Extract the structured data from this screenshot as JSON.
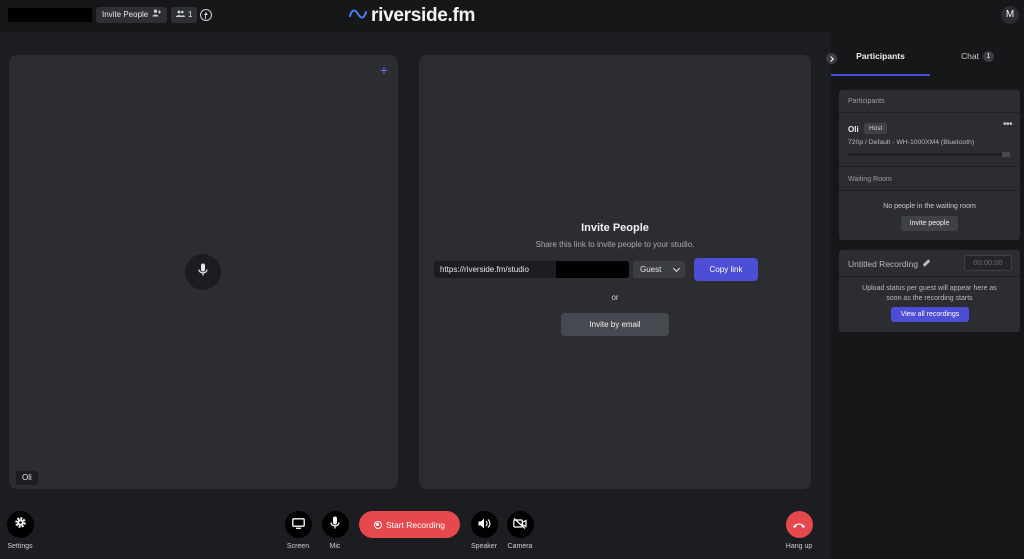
{
  "topbar": {
    "invite_label": "Invite People",
    "participant_count": "1",
    "logo_text": "riverside.fm",
    "avatar_initial": "M"
  },
  "left_tile": {
    "name_tag": "Oli"
  },
  "invite_panel": {
    "title": "Invite People",
    "subtitle": "Share this link to invite people to your studio.",
    "link_text": "https://riverside.fm/studio",
    "role_value": "Guest",
    "copy_label": "Copy link",
    "or_label": "or",
    "email_label": "Invite by email"
  },
  "sidebar": {
    "tabs": {
      "participants": "Participants",
      "chat": "Chat",
      "chat_count": "1"
    },
    "participants_card": {
      "header": "Participants",
      "participant": {
        "name": "Oli",
        "role": "Host",
        "device": "720p / Default - WH-1000XM4 (Bluetooth)"
      },
      "waiting_header": "Waiting Room",
      "waiting_empty": "No people in the waiting room",
      "invite_button": "Invite people"
    },
    "recording_card": {
      "title": "Untitled Recording",
      "timer": "00:00:00",
      "note_line1": "Upload status per guest will appear here as",
      "note_line2": "soon as the recording starts",
      "view_button": "View all recordings"
    }
  },
  "controls": {
    "settings": "Settings",
    "screen": "Screen",
    "mic": "Mic",
    "start_recording": "Start Recording",
    "speaker": "Speaker",
    "camera": "Camera",
    "hang_up": "Hang up"
  },
  "colors": {
    "accent": "#4c4fd6",
    "record_red": "#e5484d",
    "background": "#1b1d20",
    "panel": "#2b2d31"
  }
}
